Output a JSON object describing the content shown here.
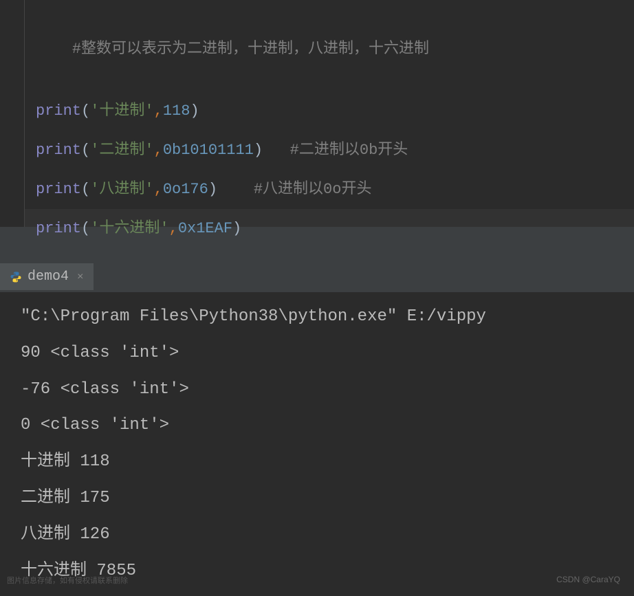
{
  "code": {
    "line1": {
      "comment": "#整数可以表示为二进制，十进制，八进制，十六进制"
    },
    "line2": {
      "func": "print",
      "paren_open": "(",
      "string": "'十进制'",
      "comma": ",",
      "number": "118",
      "paren_close": ")"
    },
    "line3": {
      "func": "print",
      "paren_open": "(",
      "string": "'二进制'",
      "comma": ",",
      "number": "0b10101111",
      "paren_close": ")",
      "spacing": "   ",
      "comment": "#二进制以0b开头"
    },
    "line4": {
      "func": "print",
      "paren_open": "(",
      "string": "'八进制'",
      "comma": ",",
      "number": "0o176",
      "paren_close": ")",
      "spacing": "    ",
      "comment": "#八进制以0o开头"
    },
    "line5": {
      "func": "print",
      "paren_open": "(",
      "string": "'十六进制'",
      "comma": ",",
      "number": "0x1EAF",
      "paren_close": ")"
    }
  },
  "tab": {
    "name": "demo4",
    "close": "×"
  },
  "console": {
    "line1": "\"C:\\Program Files\\Python38\\python.exe\" E:/vippy",
    "line2": "90 <class 'int'>",
    "line3": "-76 <class 'int'>",
    "line4": "0 <class 'int'>",
    "line5": "十进制 118",
    "line6": "二进制 175",
    "line7": "八进制 126",
    "line8": "十六进制 7855"
  },
  "watermark": "CSDN @CaraYQ",
  "watermark_left": "图片信息存储，如有侵权请联系删除"
}
